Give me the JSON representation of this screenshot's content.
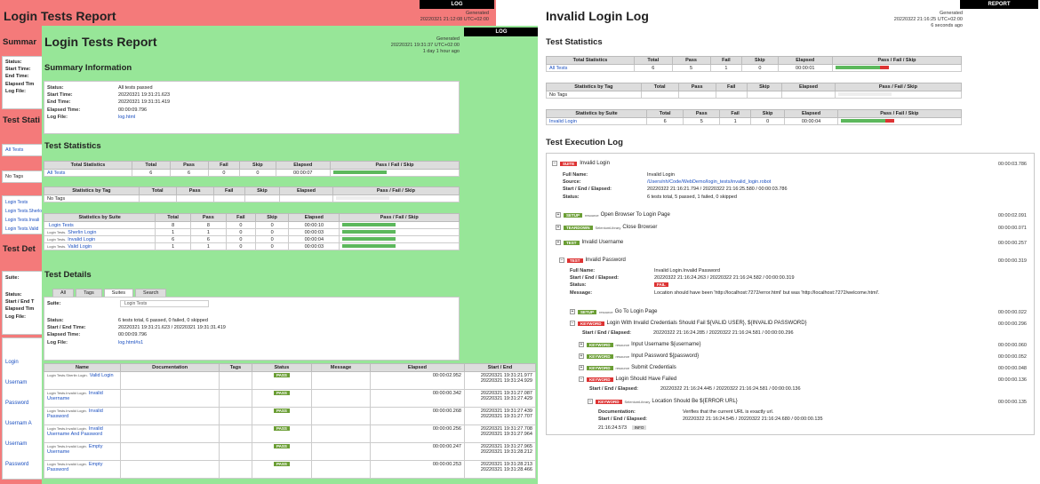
{
  "red": {
    "title": "Login Tests Report",
    "generated": "Generated",
    "gen_time": "20220321 21:12:08 UTC+02:00",
    "log_label": "LOG",
    "summary_heading": "Summar",
    "summary_labels": [
      "Status:",
      "Start Time:",
      "End Time:",
      "Elapsed Tim",
      "Log File:"
    ],
    "stats_heading": "Test Stati",
    "all_tests": "All Tests",
    "no_tags": "No Tags",
    "suite_links": [
      "Login Tests",
      "Login Tests.Sherlo",
      "Login Tests.Invali",
      "Login Tests.Valid"
    ],
    "details_heading": "Test Det",
    "suite_label": "Suite:",
    "detail_labels": [
      "Status:",
      "Start / End T",
      "Elapsed Tim",
      "Log File:"
    ],
    "rows": [
      "Login",
      "Usernam",
      "Password",
      "Usernam A",
      "Usernam",
      "Password"
    ]
  },
  "green": {
    "title": "Login Tests Report",
    "generated": "Generated",
    "gen_time": "20220321 19:31:37 UTC+02:00",
    "gen_ago": "1 day 1 hour ago",
    "log_label": "LOG",
    "summary_heading": "Summary Information",
    "summary": [
      {
        "k": "Status:",
        "v": "All tests passed"
      },
      {
        "k": "Start Time:",
        "v": "20220321 19:31:21.623"
      },
      {
        "k": "End Time:",
        "v": "20220321 19:31:31.419"
      },
      {
        "k": "Elapsed Time:",
        "v": "00:00:09.796"
      },
      {
        "k": "Log File:",
        "v": "log.html"
      }
    ],
    "stats_heading": "Test Statistics",
    "total_headers": [
      "Total Statistics",
      "Total",
      "Pass",
      "Fail",
      "Skip",
      "Elapsed",
      "Pass / Fail / Skip"
    ],
    "total_rows": [
      {
        "name": "All Tests",
        "total": "6",
        "pass": "6",
        "fail": "0",
        "skip": "0",
        "elapsed": "00:00:07"
      }
    ],
    "tag_headers": [
      "Statistics by Tag",
      "Total",
      "Pass",
      "Fail",
      "Skip",
      "Elapsed",
      "Pass / Fail / Skip"
    ],
    "tag_rows": [
      {
        "name": "No Tags"
      }
    ],
    "suite_headers": [
      "Statistics by Suite",
      "Total",
      "Pass",
      "Fail",
      "Skip",
      "Elapsed",
      "Pass / Fail / Skip"
    ],
    "suite_rows": [
      {
        "pre": "",
        "name": "Login Tests",
        "total": "8",
        "pass": "8",
        "fail": "0",
        "skip": "0",
        "elapsed": "00:00:10"
      },
      {
        "pre": "Login Tests.",
        "name": "Sherlin Login",
        "total": "1",
        "pass": "1",
        "fail": "0",
        "skip": "0",
        "elapsed": "00:00:03"
      },
      {
        "pre": "Login Tests.",
        "name": "Invalid Login",
        "total": "6",
        "pass": "6",
        "fail": "0",
        "skip": "0",
        "elapsed": "00:00:04"
      },
      {
        "pre": "Login Tests.",
        "name": "Valid Login",
        "total": "1",
        "pass": "1",
        "fail": "0",
        "skip": "0",
        "elapsed": "00:00:03"
      }
    ],
    "details_heading": "Test Details",
    "tabs": [
      "All",
      "Tags",
      "Suites",
      "Search"
    ],
    "suite_label": "Suite:",
    "suite_value": "Login Tests",
    "details": [
      {
        "k": "Status:",
        "v": "6 tests total, 6 passed, 0 failed, 0 skipped"
      },
      {
        "k": "Start / End Time:",
        "v": "20220321 19:31:21.623 / 20220321 19:31:31.419"
      },
      {
        "k": "Elapsed Time:",
        "v": "00:00:09.796"
      },
      {
        "k": "Log File:",
        "v": "log.html#s1"
      }
    ],
    "test_headers": [
      "Name",
      "Documentation",
      "Tags",
      "Status",
      "Message",
      "Elapsed",
      "Start / End"
    ],
    "tests": [
      {
        "pre": "Login Tests.Sherlin Login.",
        "name": "Valid Login",
        "status": "PASS",
        "elapsed": "00:00:02.952",
        "start": "20220321 19:31:21.977",
        "end": "20220321 19:31:24.929"
      },
      {
        "pre": "Login Tests.Invalid Login.",
        "name": "Invalid Username",
        "status": "PASS",
        "elapsed": "00:00:00.342",
        "start": "20220321 19:31:27.087",
        "end": "20220321 19:31:27.429"
      },
      {
        "pre": "Login Tests.Invalid Login.",
        "name": "Invalid Password",
        "status": "PASS",
        "elapsed": "00:00:00.268",
        "start": "20220321 19:31:27.439",
        "end": "20220321 19:31:27.707"
      },
      {
        "pre": "Login Tests.Invalid Login.",
        "name": "Invalid Username And Password",
        "status": "PASS",
        "elapsed": "00:00:00.256",
        "start": "20220321 19:31:27.708",
        "end": "20220321 19:31:27.964"
      },
      {
        "pre": "Login Tests.Invalid Login.",
        "name": "Empty Username",
        "status": "PASS",
        "elapsed": "00:00:00.247",
        "start": "20220321 19:31:27.965",
        "end": "20220321 19:31:28.212"
      },
      {
        "pre": "Login Tests.Invalid Login.",
        "name": "Empty Password",
        "status": "PASS",
        "elapsed": "00:00:00.253",
        "start": "20220321 19:31:28.213",
        "end": "20220321 19:31:28.466"
      }
    ]
  },
  "right": {
    "title": "Invalid Login Log",
    "generated": "Generated",
    "gen_time": "20220322 21:16:25 UTC+02:00",
    "gen_ago": "6 seconds ago",
    "report_label": "REPORT",
    "stats_heading": "Test Statistics",
    "total_headers": [
      "Total Statistics",
      "Total",
      "Pass",
      "Fail",
      "Skip",
      "Elapsed",
      "Pass / Fail / Skip"
    ],
    "total_row": {
      "name": "All Tests",
      "total": "6",
      "pass": "5",
      "fail": "1",
      "skip": "0",
      "elapsed": "00:00:01"
    },
    "tag_headers": [
      "Statistics by Tag",
      "Total",
      "Pass",
      "Fail",
      "Skip",
      "Elapsed",
      "Pass / Fail / Skip"
    ],
    "tag_row": {
      "name": "No Tags"
    },
    "suite_headers": [
      "Statistics by Suite",
      "Total",
      "Pass",
      "Fail",
      "Skip",
      "Elapsed",
      "Pass / Fail / Skip"
    ],
    "suite_row": {
      "name": "Invalid Login",
      "total": "6",
      "pass": "5",
      "fail": "1",
      "skip": "0",
      "elapsed": "00:00:04"
    },
    "exec_heading": "Test Execution Log",
    "suite_tag": "SUITE",
    "suite_name": "Invalid Login",
    "suite_elapsed": "00:00:03.786",
    "suite_info": [
      {
        "k": "Full Name:",
        "v": "Invalid Login"
      },
      {
        "k": "Source:",
        "v": "/Users/nh/Code/WebDemo/login_tests/invalid_login.robot"
      },
      {
        "k": "Start / End / Elapsed:",
        "v": "20220322 21:16:21.794 / 20220322 21:16:25.580 / 00:00:03.786"
      },
      {
        "k": "Status:",
        "v": "6 tests total, 5 passed, 1 failed, 0 skipped"
      }
    ],
    "setup": {
      "tag": "SETUP",
      "lib": "resource",
      "name": "Open Browser To Login Page",
      "elapsed": "00:00:02.091"
    },
    "teardown": {
      "tag": "TEARDOWN",
      "lib": "SeleniumLibrary",
      "name": "Close Browser",
      "elapsed": "00:00:00.071"
    },
    "test1": {
      "tag": "TEST",
      "name": "Invalid Username",
      "elapsed": "00:00:00.257"
    },
    "test2": {
      "tag": "TEST",
      "name": "Invalid Password",
      "elapsed": "00:00:00.319"
    },
    "test2_info": [
      {
        "k": "Full Name:",
        "v": "Invalid Login.Invalid Password"
      },
      {
        "k": "Start / End / Elapsed:",
        "v": "20220322 21:16:24.263 / 20220322 21:16:24.582 / 00:00:00.319"
      },
      {
        "k": "Status:",
        "v": "FAIL"
      },
      {
        "k": "Message:",
        "v": "Location should have been 'http://localhost:7272/error.html' but was 'http://localhost:7272/welcome.html'."
      }
    ],
    "t2_setup": {
      "tag": "SETUP",
      "lib": "resource",
      "name": "Go To Login Page",
      "elapsed": "00:00:00.022"
    },
    "kw_main": {
      "tag": "KEYWORD",
      "name": "Login With Invalid Credentials Should Fail ${VALID USER}, ${INVALID PASSWORD}",
      "elapsed": "00:00:00.296"
    },
    "kw_main_time_k": "Start / End / Elapsed:",
    "kw_main_time": "20220322 21:16:24.285 / 20220322 21:16:24.581 / 00:00:00.296",
    "kw_subs": [
      {
        "tag": "KEYWORD",
        "lib": "resource",
        "name": "Input Username ${username}",
        "elapsed": "00:00:00.060"
      },
      {
        "tag": "KEYWORD",
        "lib": "resource",
        "name": "Input Password ${password}",
        "elapsed": "00:00:00.052"
      },
      {
        "tag": "KEYWORD",
        "lib": "resource",
        "name": "Submit Credentials",
        "elapsed": "00:00:00.048"
      }
    ],
    "kw_fail": {
      "tag": "KEYWORD",
      "name": "Login Should Have Failed",
      "elapsed": "00:00:00.136"
    },
    "kw_fail_time_k": "Start / End / Elapsed:",
    "kw_fail_time": "20220322 21:16:24.445 / 20220322 21:16:24.581 / 00:00:00.136",
    "kw_loc": {
      "tag": "KEYWORD",
      "lib": "SeleniumLibrary",
      "name": "Location Should Be ${ERROR URL}",
      "elapsed": "00:00:00.135"
    },
    "kw_loc_info": [
      {
        "k": "Documentation:",
        "v": "Verifies that the current URL is exactly url."
      },
      {
        "k": "Start / End / Elapsed:",
        "v": "20220322 21:16:24.545 / 20220322 21:16:24.680 / 00:00:00.135"
      }
    ],
    "last_time": "21:16:24.573",
    "last_level": "INFO"
  }
}
